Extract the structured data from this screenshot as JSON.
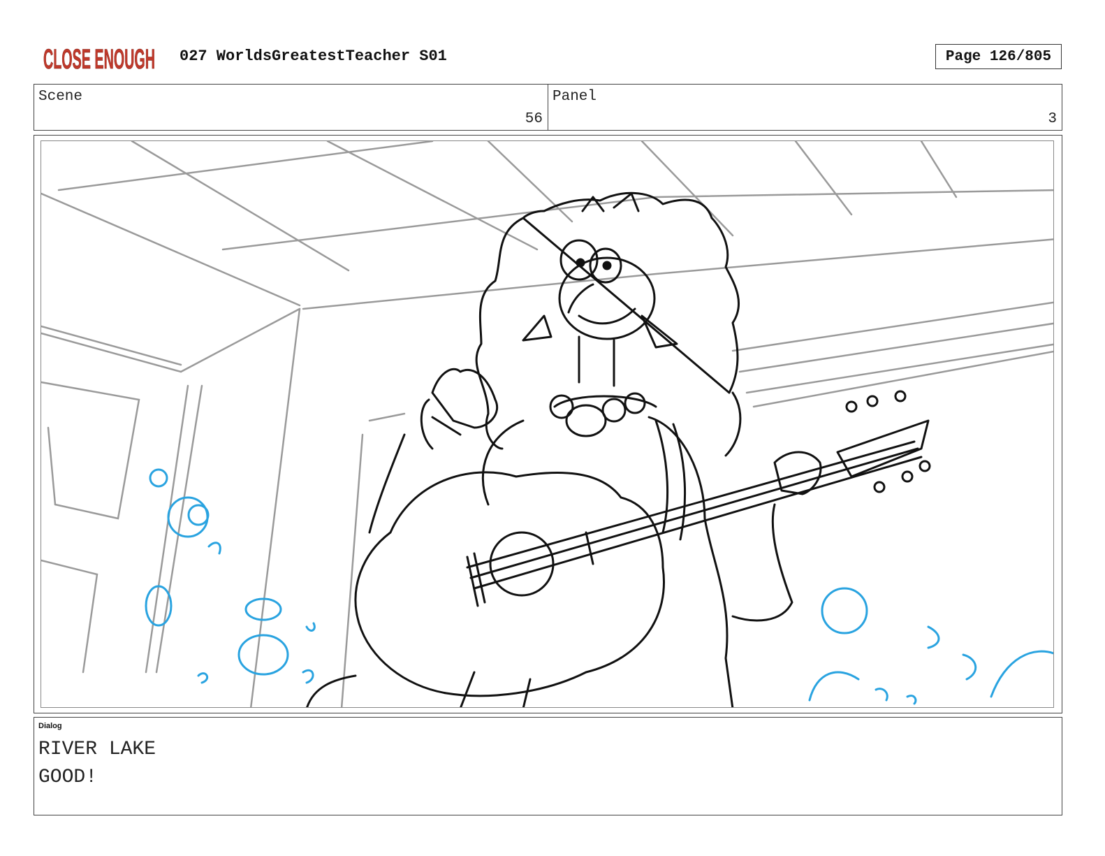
{
  "header": {
    "logo_text": "CLOSE ENOUGH",
    "title": "027 WorldsGreatestTeacher S01",
    "page": "Page 126/805"
  },
  "info": {
    "scene_label": "Scene",
    "scene_value": "56",
    "panel_label": "Panel",
    "panel_value": "3"
  },
  "panel_image": {
    "icon": "storyboard-sketch-woman-playing-guitar",
    "accent_color": "#29a3e0"
  },
  "dialog": {
    "label": "Dialog",
    "lines": [
      "RIVER LAKE",
      "GOOD!"
    ]
  },
  "colors": {
    "logo": "#c0392b",
    "sketch_gray": "#9a9a9a",
    "sketch_black": "#111111",
    "sketch_blue": "#29a3e0"
  }
}
